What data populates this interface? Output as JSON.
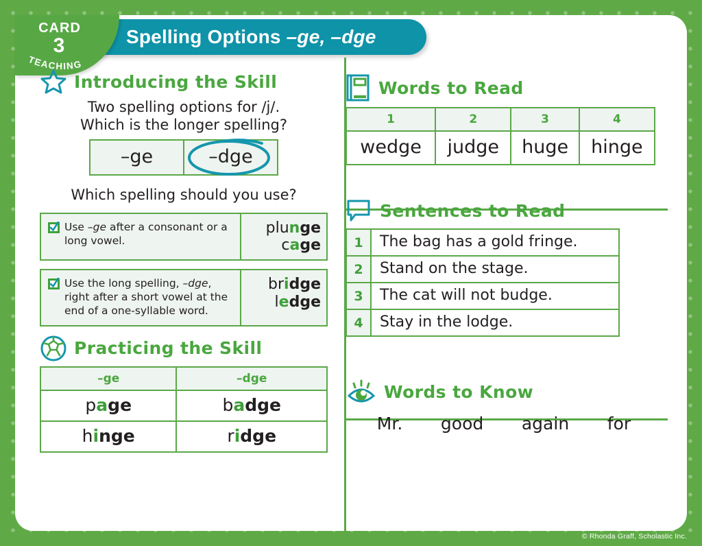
{
  "badge": {
    "card_label": "CARD",
    "number": "3",
    "type_label": "TEACHING"
  },
  "header": {
    "title_plain": "Spelling Options ",
    "title_italic": "–ge, –dge"
  },
  "colors": {
    "green": "#4aa73f",
    "teal": "#0e93a8",
    "border_green": "#5aa847",
    "tint": "#eef4f0"
  },
  "introducing": {
    "icon": "star-icon",
    "title": "Introducing the Skill",
    "prompt_line1": "Two spelling options for /j/.",
    "prompt_line2": "Which is the longer spelling?",
    "options": [
      "–ge",
      "–dge"
    ],
    "circled_option": "–dge",
    "question": "Which spelling should you use?",
    "rules": [
      {
        "text": "Use –ge after a consonant or a long vowel.",
        "text_pre": "Use ",
        "text_em": "–ge",
        "text_post": " after a consonant or a long vowel.",
        "words": [
          {
            "pre": "plu",
            "mid": "n",
            "suffix": "ge"
          },
          {
            "pre": "c",
            "mid": "a",
            "suffix": "ge"
          }
        ]
      },
      {
        "text": "Use the long spelling, –dge, right after a short vowel at the end of a one-syllable word.",
        "text_pre": "Use the long spelling, ",
        "text_em": "–dge",
        "text_post": ", right after a short vowel at the end of a one-syllable word.",
        "words": [
          {
            "pre": "br",
            "mid": "i",
            "suffix": "dge"
          },
          {
            "pre": "l",
            "mid": "e",
            "suffix": "dge"
          }
        ]
      }
    ]
  },
  "practicing": {
    "icon": "ball-icon",
    "title": "Practicing the Skill",
    "headers": [
      "–ge",
      "–dge"
    ],
    "rows": [
      [
        {
          "pre": "p",
          "mid": "a",
          "suffix": "ge"
        },
        {
          "pre": "b",
          "mid": "a",
          "suffix": "dge"
        }
      ],
      [
        {
          "pre": "h",
          "mid": "i",
          "suffix": "nge"
        },
        {
          "pre": "r",
          "mid": "i",
          "suffix": "dge"
        }
      ]
    ]
  },
  "words_to_read": {
    "icon": "book-icon",
    "title": "Words to Read",
    "numbers": [
      "1",
      "2",
      "3",
      "4"
    ],
    "words": [
      "wedge",
      "judge",
      "huge",
      "hinge"
    ]
  },
  "sentences_to_read": {
    "icon": "speech-bubble-icon",
    "title": "Sentences to Read",
    "items": [
      {
        "num": "1",
        "text": "The bag has a gold fringe."
      },
      {
        "num": "2",
        "text": "Stand on the stage."
      },
      {
        "num": "3",
        "text": "The cat will not budge."
      },
      {
        "num": "4",
        "text": "Stay in the lodge."
      }
    ]
  },
  "words_to_know": {
    "icon": "eye-icon",
    "title": "Words to Know",
    "words": [
      "Mr.",
      "good",
      "again",
      "for"
    ]
  },
  "footer": {
    "copyright": "© Rhonda Graff, Scholastic Inc."
  }
}
